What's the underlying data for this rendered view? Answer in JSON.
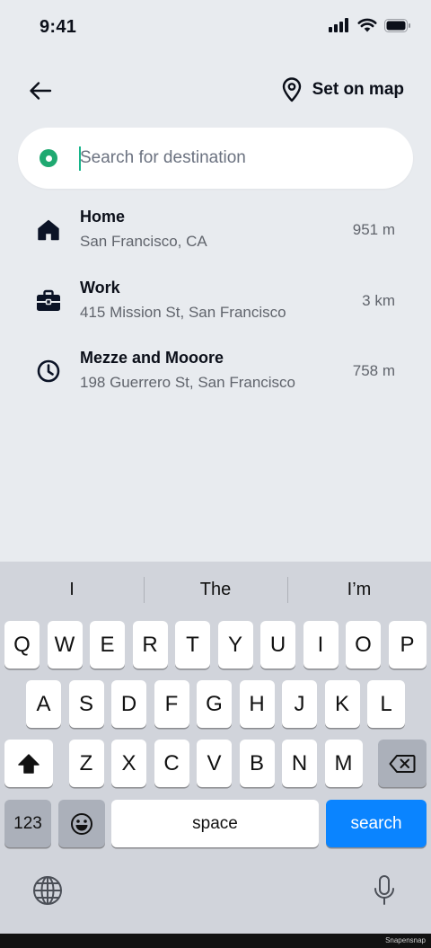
{
  "status": {
    "time": "9:41"
  },
  "header": {
    "set_on_map": "Set on map"
  },
  "search": {
    "placeholder": "Search for destination",
    "value": ""
  },
  "results": [
    {
      "icon": "home-icon",
      "title": "Home",
      "subtitle": "San Francisco, CA",
      "distance": "951 m"
    },
    {
      "icon": "briefcase-icon",
      "title": "Work",
      "subtitle": "415 Mission St, San Francisco",
      "distance": "3 km"
    },
    {
      "icon": "clock-icon",
      "title": "Mezze and Mooore",
      "subtitle": "198 Guerrero St, San Francisco",
      "distance": "758 m"
    }
  ],
  "keyboard": {
    "suggestions": [
      "I",
      "The",
      "I’m"
    ],
    "row1": [
      "Q",
      "W",
      "E",
      "R",
      "T",
      "Y",
      "U",
      "I",
      "O",
      "P"
    ],
    "row2": [
      "A",
      "S",
      "D",
      "F",
      "G",
      "H",
      "J",
      "K",
      "L"
    ],
    "row3": [
      "Z",
      "X",
      "C",
      "V",
      "B",
      "N",
      "M"
    ],
    "numbers_label": "123",
    "space_label": "space",
    "search_label": "search"
  },
  "watermark": "Snapensnap",
  "colors": {
    "accent": "#1fa971",
    "caret": "#17b58a",
    "search_key": "#0a84ff",
    "background": "#e8ebef"
  }
}
